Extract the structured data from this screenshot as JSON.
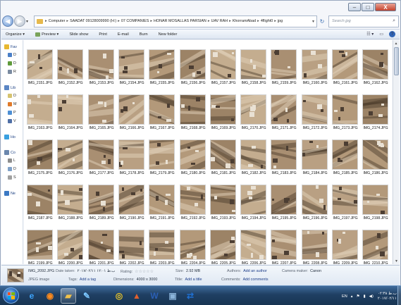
{
  "window": {
    "buttons": {
      "minimize": "–",
      "maximize": "□",
      "close": "X"
    }
  },
  "address": {
    "crumbs": [
      "Computer",
      "SAADAT 09128009990 (H:)",
      "07 COMPANIES",
      "HONAR MOSALLAS PARSIAN",
      "UAV RAH",
      "KhorramAbad",
      "4flight0",
      "jpg"
    ],
    "search_placeholder": "Search jpg",
    "back_icon": "back-arrow-icon",
    "forward_icon": "forward-arrow-icon"
  },
  "toolbar": {
    "organize": "Organize ▾",
    "preview": "Preview ▾",
    "slideshow": "Slide show",
    "print": "Print",
    "email": "E-mail",
    "burn": "Burn",
    "new_folder": "New folder"
  },
  "navigation": [
    {
      "label": "Fav",
      "icon": "star-icon",
      "color": "#e8b830"
    },
    {
      "label": "D",
      "icon": "desktop-icon",
      "color": "#4a7fc7"
    },
    {
      "label": "D",
      "icon": "downloads-icon",
      "color": "#5f9a3b"
    },
    {
      "label": "R",
      "icon": "recent-places-icon",
      "color": "#7a8aa0"
    },
    {
      "label": "Lib",
      "icon": "libraries-icon",
      "color": "#5b86c4"
    },
    {
      "label": "D",
      "icon": "documents-icon",
      "color": "#d6c36f"
    },
    {
      "label": "M",
      "icon": "music-icon",
      "color": "#e07a2a"
    },
    {
      "label": "P",
      "icon": "pictures-icon",
      "color": "#4d8fd4"
    },
    {
      "label": "V",
      "icon": "videos-icon",
      "color": "#4f6fa6"
    },
    {
      "label": "Ho",
      "icon": "homegroup-icon",
      "color": "#3aa0e0"
    },
    {
      "label": "Co",
      "icon": "computer-icon",
      "color": "#6b87ad"
    },
    {
      "label": "L",
      "icon": "local-disk-icon",
      "color": "#8d8d8d"
    },
    {
      "label": "D",
      "icon": "drive-icon",
      "color": "#7fa0c7"
    },
    {
      "label": "S",
      "icon": "drive-icon",
      "color": "#a0a0a0"
    },
    {
      "label": "Ne",
      "icon": "network-icon",
      "color": "#3c79c4"
    }
  ],
  "files": [
    "IMG_2151.JPG",
    "IMG_2152.JPG",
    "IMG_2153.JPG",
    "IMG_2154.JPG",
    "IMG_2155.JPG",
    "IMG_2156.JPG",
    "IMG_2157.JPG",
    "IMG_2158.JPG",
    "IMG_2159.JPG",
    "IMG_2160.JPG",
    "IMG_2161.JPG",
    "IMG_2162.JPG",
    "IMG_2163.JPG",
    "IMG_2164.JPG",
    "IMG_2165.JPG",
    "IMG_2166.JPG",
    "IMG_2167.JPG",
    "IMG_2168.JPG",
    "IMG_2169.JPG",
    "IMG_2170.JPG",
    "IMG_2171.JPG",
    "IMG_2172.JPG",
    "IMG_2173.JPG",
    "IMG_2174.JPG",
    "IMG_2175.JPG",
    "IMG_2176.JPG",
    "IMG_2177.JPG",
    "IMG_2178.JPG",
    "IMG_2179.JPG",
    "IMG_2180.JPG",
    "IMG_2181.JPG",
    "IMG_2182.JPG",
    "IMG_2183.JPG",
    "IMG_2184.JPG",
    "IMG_2185.JPG",
    "IMG_2186.JPG",
    "IMG_2187.JPG",
    "IMG_2188.JPG",
    "IMG_2189.JPG",
    "IMG_2190.JPG",
    "IMG_2191.JPG",
    "IMG_2192.JPG",
    "IMG_2193.JPG",
    "IMG_2194.JPG",
    "IMG_2195.JPG",
    "IMG_2196.JPG",
    "IMG_2197.JPG",
    "IMG_2198.JPG",
    "IMG_2199.JPG",
    "IMG_2200.JPG",
    "IMG_2201.JPG",
    "IMG_2202.JPG",
    "IMG_2203.JPG",
    "IMG_2204.JPG",
    "IMG_2205.JPG",
    "IMG_2206.JPG",
    "IMG_2207.JPG",
    "IMG_2208.JPG",
    "IMG_2209.JPG",
    "IMG_2210.JPG"
  ],
  "details": {
    "filename": "IMG_2092.JPG",
    "filetype": "JPEG image",
    "date_taken_label": "Date taken:",
    "date_taken_value": "۲۰۱۷/۰۲/۱۱ ب.ظ ۱۲:۰۱",
    "tags_label": "Tags:",
    "tags_value": "Add a tag",
    "rating_label": "Rating:",
    "rating_stars": "☆☆☆☆☆",
    "dimensions_label": "Dimensions:",
    "dimensions_value": "4000 x 3000",
    "size_label": "Size:",
    "size_value": "2.92 MB",
    "title_label": "Title:",
    "title_value": "Add a title",
    "authors_label": "Authors:",
    "authors_value": "Add an author",
    "comments_label": "Comments:",
    "comments_value": "Add comments",
    "camera_label": "Camera maker:",
    "camera_value": "Canon"
  },
  "taskbar": {
    "apps": [
      {
        "name": "ie",
        "icon": "internet-explorer-icon",
        "glyph": "e",
        "color": "#3ea6ff"
      },
      {
        "name": "firefox",
        "icon": "firefox-icon",
        "glyph": "◉",
        "color": "#ff8a1c"
      },
      {
        "name": "explorer",
        "icon": "folder-icon",
        "glyph": "▰",
        "color": "#f0c14b"
      },
      {
        "name": "paint",
        "icon": "paint-icon",
        "glyph": "✎",
        "color": "#7cc7ff"
      },
      {
        "name": "chrome",
        "icon": "chrome-icon",
        "glyph": "◎",
        "color": "#e5c22a"
      },
      {
        "name": "matlab",
        "icon": "matlab-icon",
        "glyph": "▲",
        "color": "#e0602d"
      },
      {
        "name": "word",
        "icon": "word-icon",
        "glyph": "W",
        "color": "#2b5fb4"
      },
      {
        "name": "photos",
        "icon": "photo-viewer-icon",
        "glyph": "▣",
        "color": "#8ab3d9"
      },
      {
        "name": "teamviewer",
        "icon": "teamviewer-icon",
        "glyph": "⇄",
        "color": "#1f6fd1"
      }
    ],
    "language": "EN",
    "clock_time": "۰۲:۳۸ ب.ظ",
    "clock_date": "۲۰۱۷/۰۲/۱۱"
  }
}
